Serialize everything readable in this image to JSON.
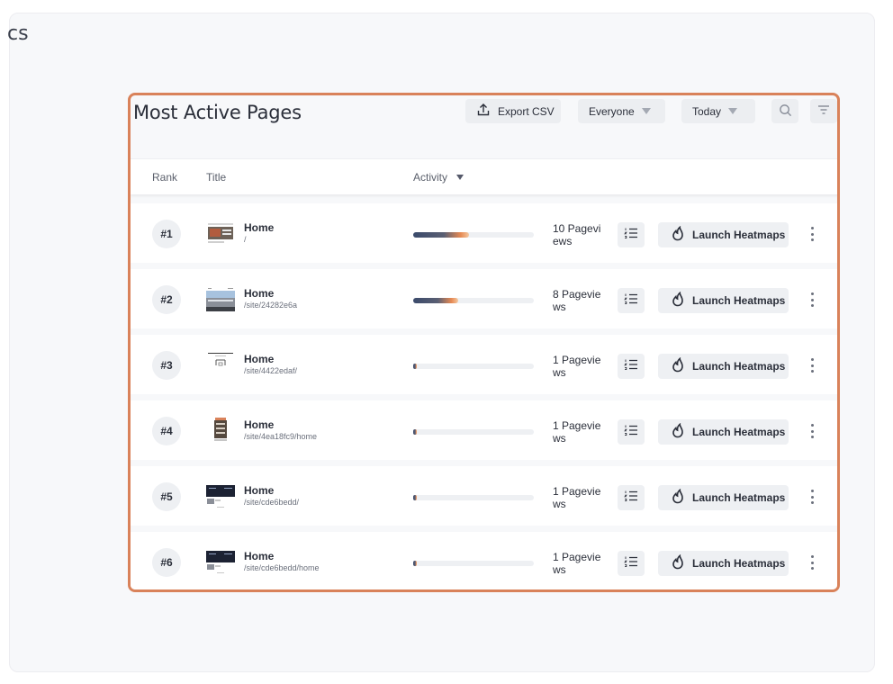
{
  "page": {
    "heading_fragment": "cs"
  },
  "card": {
    "title": "Most Active Pages",
    "toolbar": {
      "export_label": "Export CSV",
      "audience_selected": "Everyone",
      "range_selected": "Today"
    },
    "columns": {
      "rank": "Rank",
      "title": "Title",
      "activity": "Activity"
    },
    "heatmap_label": "Launch Heatmaps",
    "rows": [
      {
        "rank": "#1",
        "name": "Home",
        "path": "/",
        "pageviews": "10 Pageviews",
        "activity_fraction": 0.46
      },
      {
        "rank": "#2",
        "name": "Home",
        "path": "/site/24282e6a",
        "pageviews": "8 Pageviews",
        "activity_fraction": 0.37
      },
      {
        "rank": "#3",
        "name": "Home",
        "path": "/site/4422edaf/",
        "pageviews": "1 Pageviews",
        "activity_fraction": 0.03
      },
      {
        "rank": "#4",
        "name": "Home",
        "path": "/site/4ea18fc9/home",
        "pageviews": "1 Pageviews",
        "activity_fraction": 0.03
      },
      {
        "rank": "#5",
        "name": "Home",
        "path": "/site/cde6bedd/",
        "pageviews": "1 Pageviews",
        "activity_fraction": 0.03
      },
      {
        "rank": "#6",
        "name": "Home",
        "path": "/site/cde6bedd/home",
        "pageviews": "1 Pageviews",
        "activity_fraction": 0.03
      }
    ]
  },
  "colors": {
    "highlight_border": "#d9825a",
    "bar_start": "#3a4a6b",
    "bar_end": "#e68a54"
  },
  "icons": {
    "export": "upload-icon",
    "dropdown": "caret-down-icon",
    "search": "search-icon",
    "filter": "filter-icon",
    "list": "numbered-list-icon",
    "heatmap": "flame-icon",
    "more": "more-vertical-icon"
  }
}
